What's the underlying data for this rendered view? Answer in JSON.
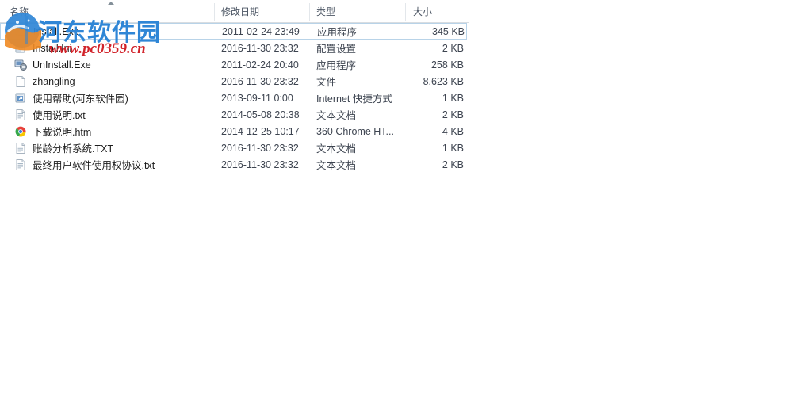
{
  "header": {
    "columns": [
      {
        "key": "name",
        "label": "名称",
        "sorted": true,
        "sort_dir": "asc"
      },
      {
        "key": "date",
        "label": "修改日期"
      },
      {
        "key": "type",
        "label": "类型"
      },
      {
        "key": "size",
        "label": "大小"
      }
    ]
  },
  "files": [
    {
      "name": "Install.Exe",
      "icon": "application-exe-icon",
      "date": "2011-02-24 23:49",
      "type": "应用程序",
      "size": "345 KB",
      "selected": true
    },
    {
      "name": "Install.Ini",
      "icon": "ini-config-icon",
      "date": "2016-11-30 23:32",
      "type": "配置设置",
      "size": "2 KB",
      "selected": false
    },
    {
      "name": "UnInstall.Exe",
      "icon": "uninstall-exe-icon",
      "date": "2011-02-24 20:40",
      "type": "应用程序",
      "size": "258 KB",
      "selected": false
    },
    {
      "name": "zhangling",
      "icon": "blank-file-icon",
      "date": "2016-11-30 23:32",
      "type": "文件",
      "size": "8,623 KB",
      "selected": false
    },
    {
      "name": "使用帮助(河东软件园)",
      "icon": "internet-shortcut-icon",
      "date": "2013-09-11 0:00",
      "type": "Internet 快捷方式",
      "size": "1 KB",
      "selected": false
    },
    {
      "name": "使用说明.txt",
      "icon": "text-document-icon",
      "date": "2014-05-08 20:38",
      "type": "文本文档",
      "size": "2 KB",
      "selected": false
    },
    {
      "name": "下载说明.htm",
      "icon": "chrome-html-icon",
      "date": "2014-12-25 10:17",
      "type": "360 Chrome HT...",
      "size": "4 KB",
      "selected": false
    },
    {
      "name": "账龄分析系统.TXT",
      "icon": "text-document-icon",
      "date": "2016-11-30 23:32",
      "type": "文本文档",
      "size": "1 KB",
      "selected": false
    },
    {
      "name": "最终用户软件使用权协议.txt",
      "icon": "text-document-icon",
      "date": "2016-11-30 23:32",
      "type": "文本文档",
      "size": "2 KB",
      "selected": false
    }
  ],
  "watermark": {
    "title": "河东软件园",
    "url": "www.pc0359.cn",
    "title_color": "#2f86d6",
    "url_color": "#d1232a"
  }
}
